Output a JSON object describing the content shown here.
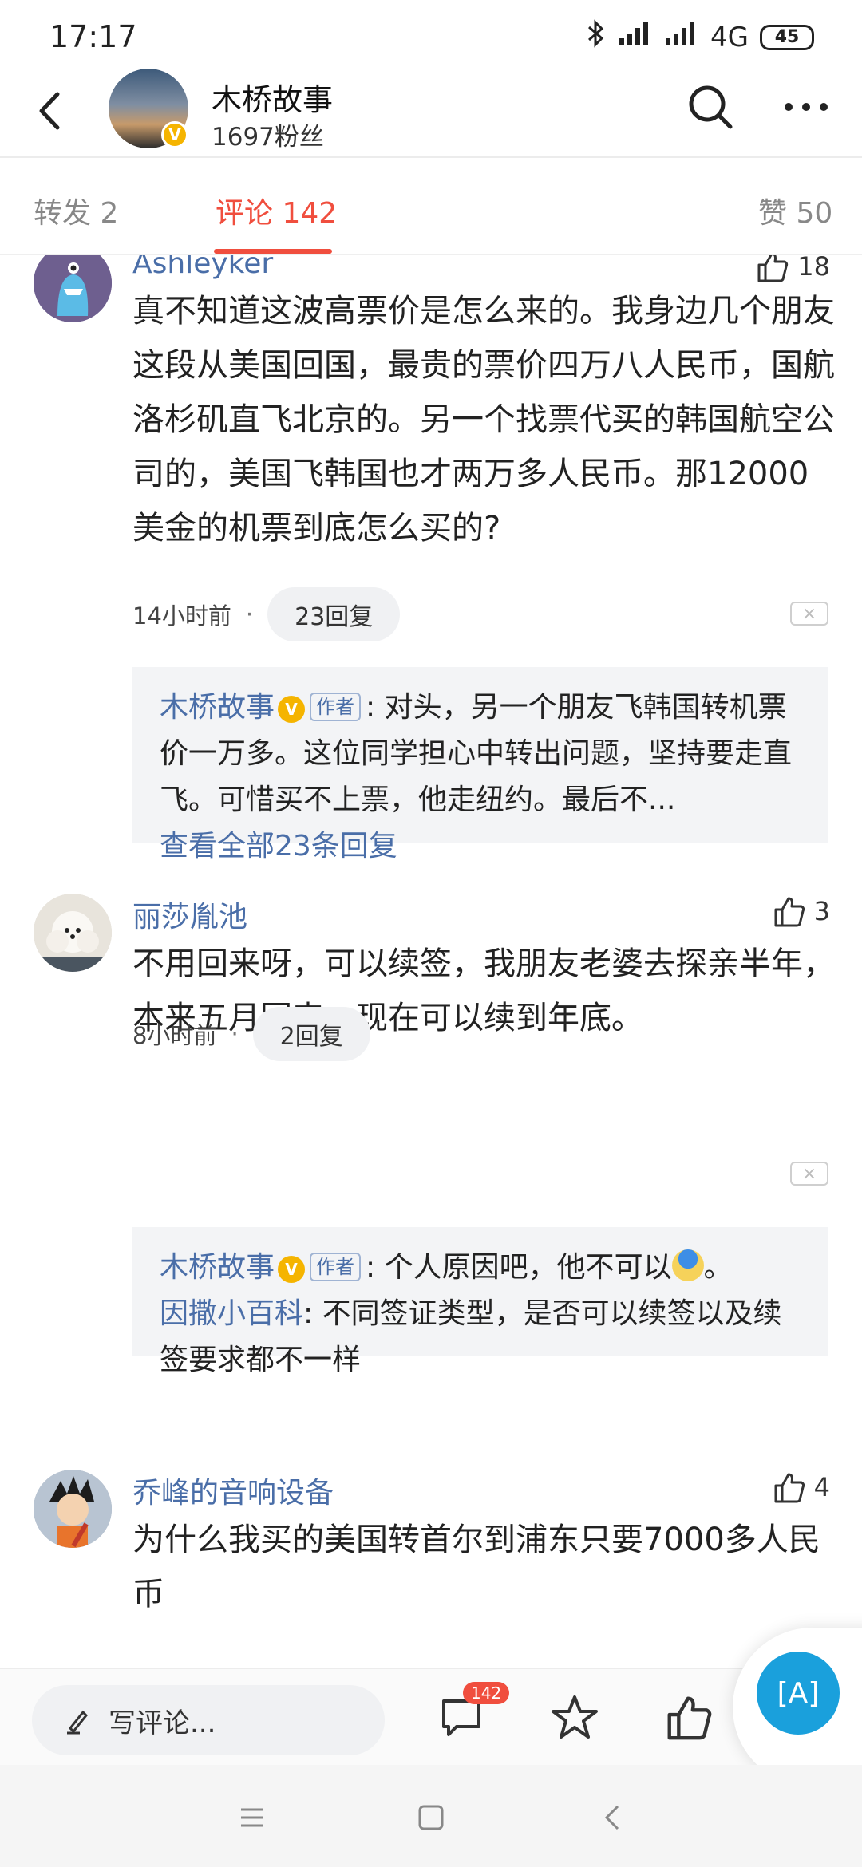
{
  "status_bar": {
    "time": "17:17",
    "network": "4G",
    "battery": "45"
  },
  "header": {
    "name": "木桥故事",
    "fans": "1697粉丝",
    "verified": "V"
  },
  "tabs": [
    {
      "label": "转发 2"
    },
    {
      "label": "评论 142"
    },
    {
      "label": "赞 50"
    }
  ],
  "comments": [
    {
      "user": "Ashleyker",
      "likes": "18",
      "text": "真不知道这波高票价是怎么来的。我身边几个朋友这段从美国回国，最贵的票价四万八人民币，国航洛杉矶直飞北京的。另一个找票代买的韩国航空公司的，美国飞韩国也才两万多人民币。那12000美金的机票到底怎么买的?",
      "time": "14小时前",
      "replies_label": "23回复",
      "reply_box": {
        "reply1_name": "木桥故事",
        "author_tag": "作者",
        "reply1_text": ": 对头，另一个朋友飞韩国转机票价一万多。这位同学担心中转出问题，坚持要走直飞。可惜买不上票，他走纽约。最后不...",
        "view_all": "查看全部23条回复"
      }
    },
    {
      "user": "丽莎胤池",
      "likes": "3",
      "text": "不用回来呀，可以续签，我朋友老婆去探亲半年，本来五月回来，现在可以续到年底。",
      "time": "8小时前",
      "replies_label": "2回复",
      "reply_box": {
        "reply1_name": "木桥故事",
        "author_tag": "作者",
        "reply1_text": ": 个人原因吧，他不可以",
        "reply1_end": "。",
        "reply2_name": "因撒小百科",
        "reply2_text": ": 不同签证类型，是否可以续签以及续签要求都不一样"
      }
    },
    {
      "user": "乔峰的音响设备",
      "likes": "4",
      "text": "为什么我买的美国转首尔到浦东只要7000多人民币"
    }
  ],
  "action_bar": {
    "write_placeholder": "写评论...",
    "comment_count": "142"
  },
  "float_button": {
    "label": "[A]"
  }
}
